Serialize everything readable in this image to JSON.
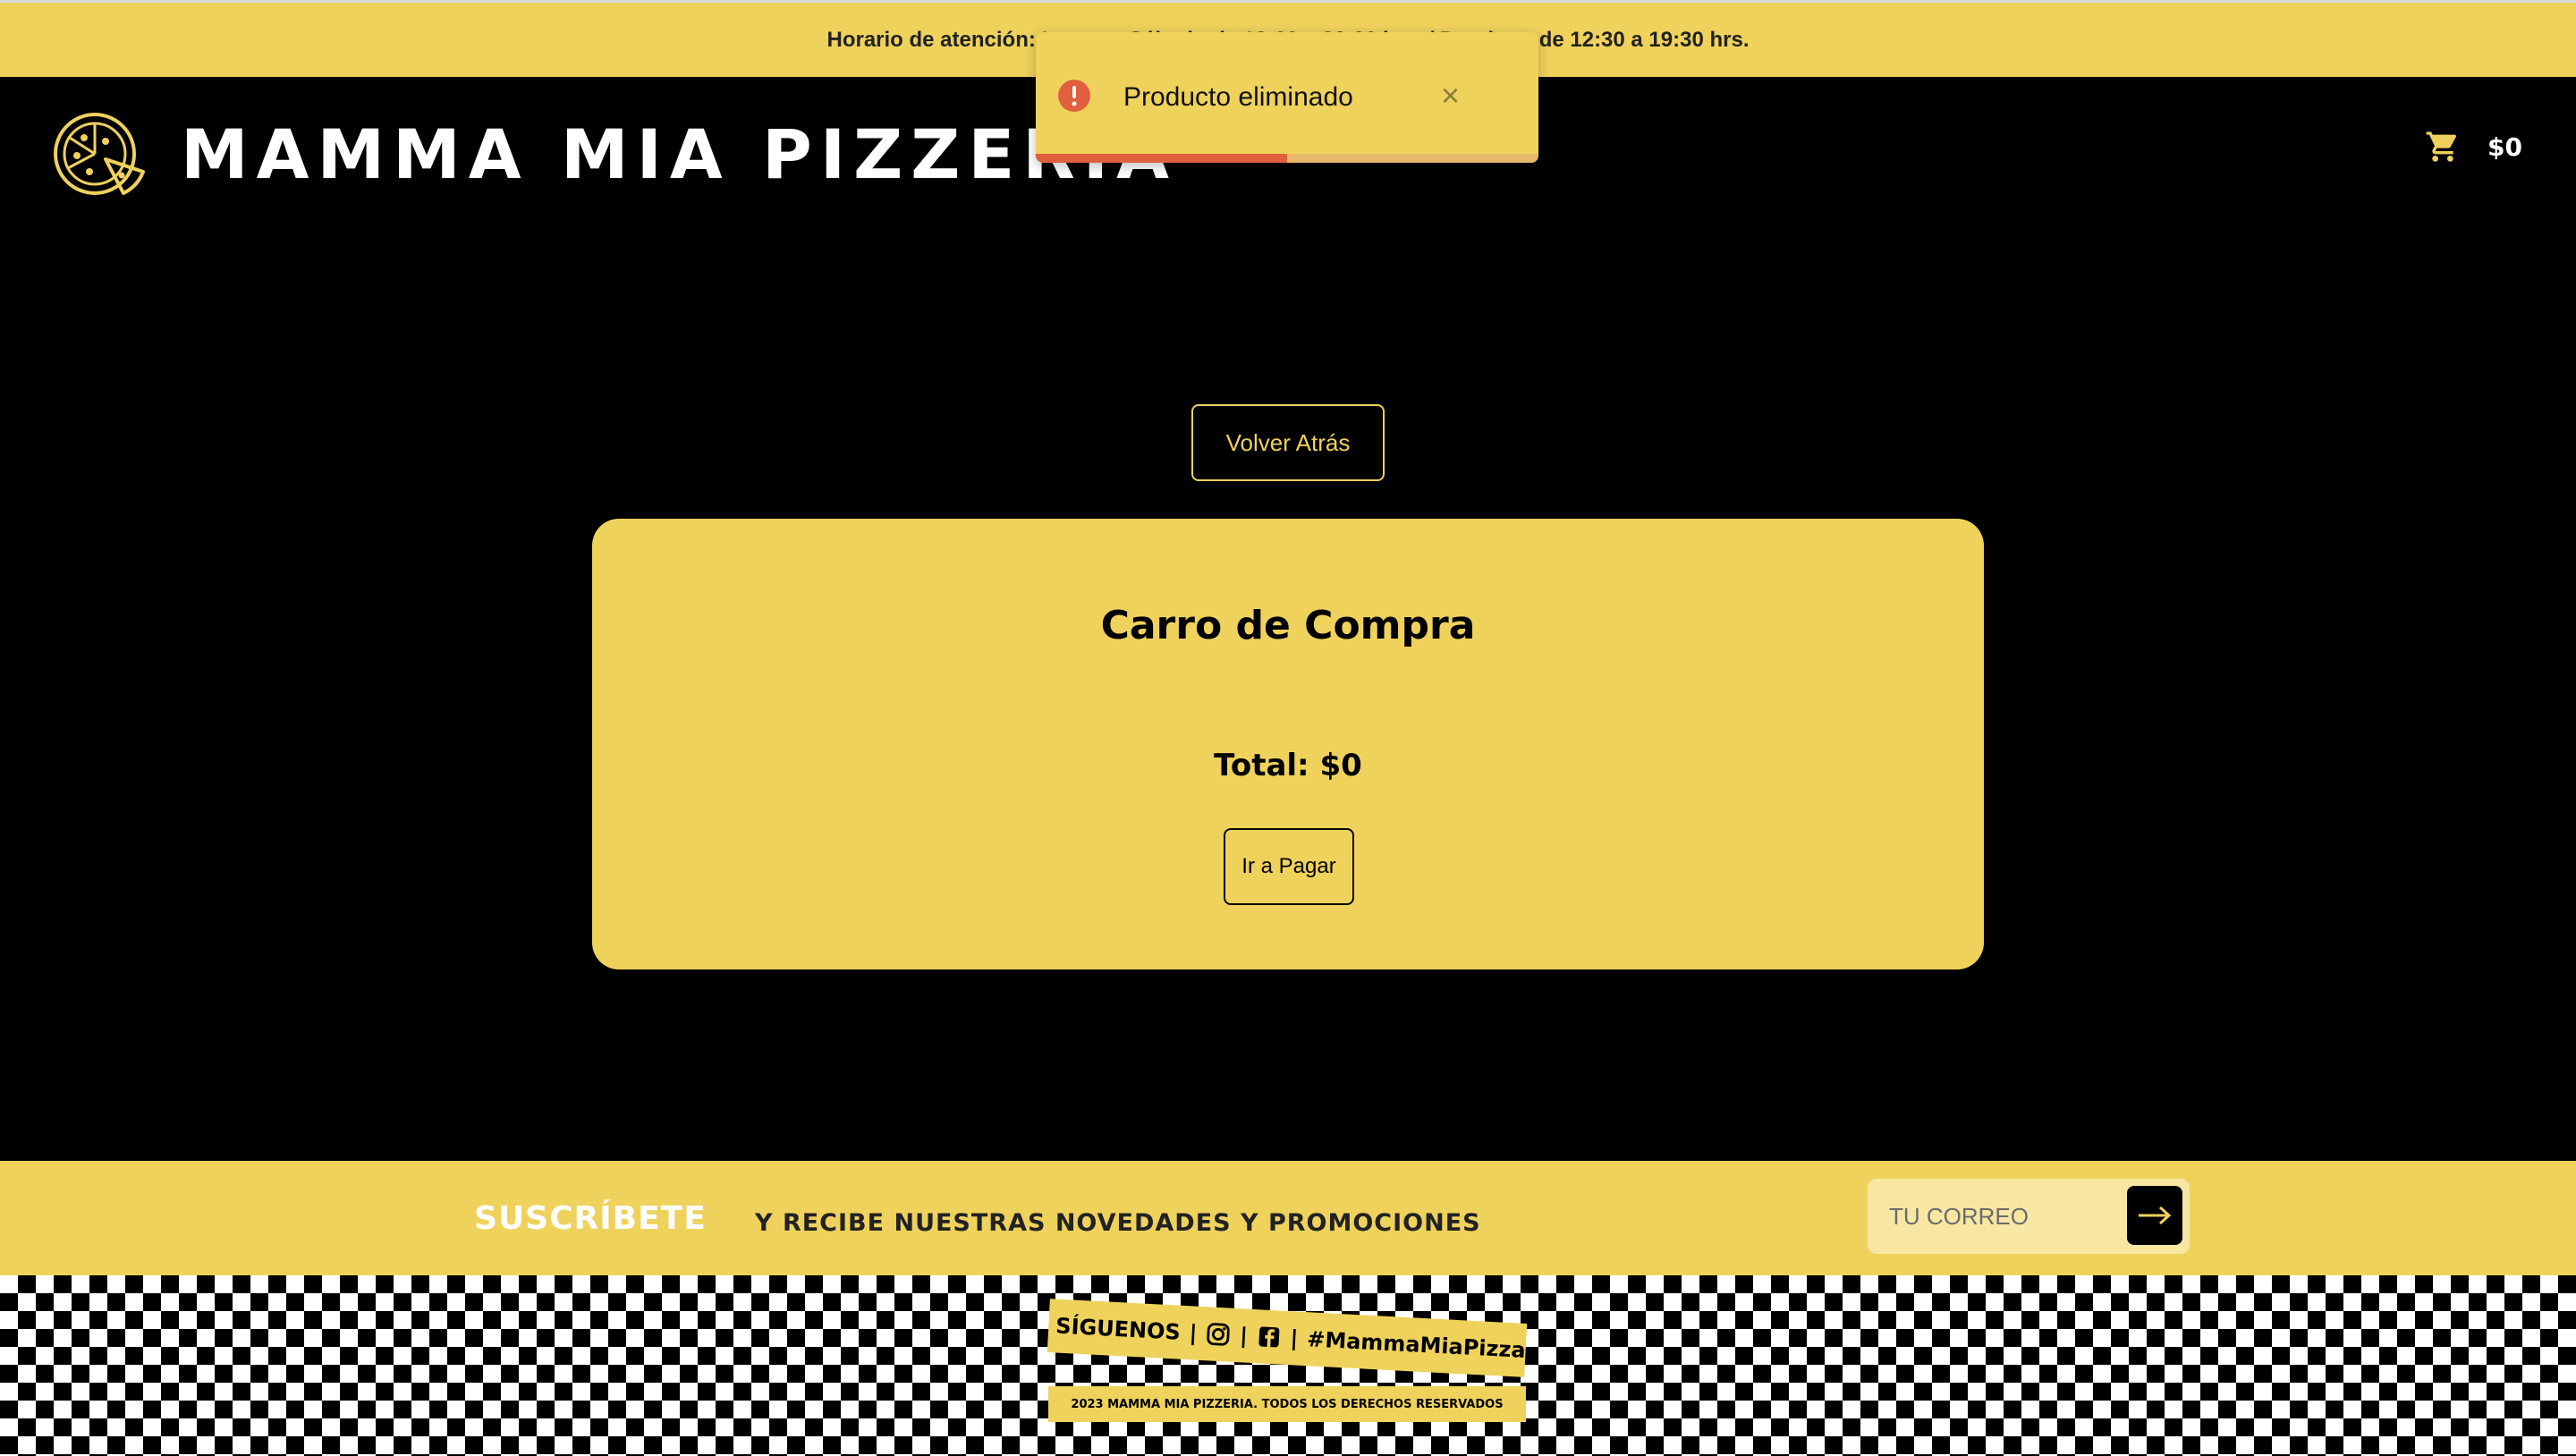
{
  "topbar": {
    "hours_text": "Horario de atención: Lunes a Sábado de 12:00 a 23:30 hrs. / Domingo de 12:30 a 19:30 hrs."
  },
  "navbar": {
    "brand_title": "MAMMA MIA PIZZERIA",
    "logo_icon": "pizza-icon",
    "cart_icon": "cart-icon",
    "cart_total": "$0"
  },
  "toast": {
    "icon": "error-icon",
    "message": "Producto eliminado",
    "close_label": "×",
    "progress": 0.5
  },
  "main": {
    "back_button_label": "Volver Atrás",
    "cart_title": "Carro de Compra",
    "total_label": "Total: $0",
    "pay_button_label": "Ir a Pagar"
  },
  "subscribe": {
    "title": "SUSCRÍBETE",
    "text": "Y RECIBE NUESTRAS NOVEDADES Y PROMOCIONES",
    "email_placeholder": "TU CORREO",
    "submit_icon": "arrow-right-icon"
  },
  "footer": {
    "follow_label": "SÍGUENOS",
    "separator": "|",
    "instagram_icon": "instagram-icon",
    "facebook_icon": "facebook-icon",
    "hashtag": "#MammaMiaPizza",
    "copyright": "2023 MAMMA MIA PIZZERIA. TODOS LOS DERECHOS RESERVADOS"
  },
  "colors": {
    "brand_yellow": "#efd25c",
    "background": "#000000",
    "toast_error": "#e05f3f"
  }
}
